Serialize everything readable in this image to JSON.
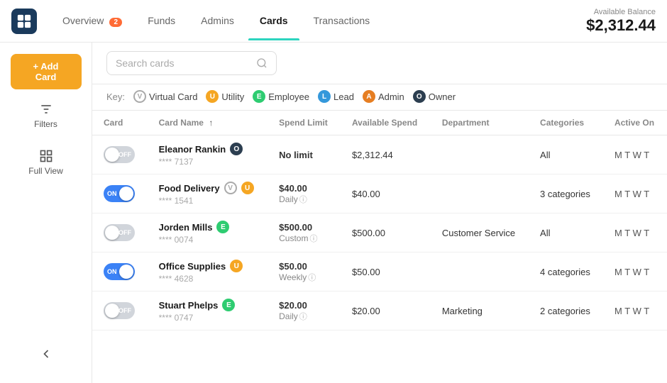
{
  "nav": {
    "items": [
      {
        "label": "Overview",
        "badge": "2",
        "active": false
      },
      {
        "label": "Funds",
        "badge": null,
        "active": false
      },
      {
        "label": "Admins",
        "badge": null,
        "active": false
      },
      {
        "label": "Cards",
        "badge": null,
        "active": true
      },
      {
        "label": "Transactions",
        "badge": null,
        "active": false
      }
    ],
    "balance_label": "Available Balance",
    "balance_amount": "$2,312.44"
  },
  "sidebar": {
    "add_card": "+ Add Card",
    "filters": "Filters",
    "full_view": "Full View"
  },
  "toolbar": {
    "search_placeholder": "Search cards"
  },
  "key": {
    "label": "Key:",
    "items": [
      {
        "badge": "V",
        "type": "v",
        "label": "Virtual Card"
      },
      {
        "badge": "U",
        "type": "u",
        "label": "Utility"
      },
      {
        "badge": "E",
        "type": "e",
        "label": "Employee"
      },
      {
        "badge": "L",
        "type": "l",
        "label": "Lead"
      },
      {
        "badge": "A",
        "type": "a",
        "label": "Admin"
      },
      {
        "badge": "O",
        "type": "o",
        "label": "Owner"
      }
    ]
  },
  "table": {
    "headers": [
      "Card",
      "Card Name",
      "Spend Limit",
      "Available Spend",
      "Department",
      "Categories",
      "Active On"
    ],
    "rows": [
      {
        "toggle": "off",
        "name": "Eleanor Rankin",
        "badge": "O",
        "badge_type": "o",
        "number": "**** 7137",
        "spend_limit": "No limit",
        "spend_period": "",
        "available_spend": "$2,312.44",
        "department": "",
        "categories": "All",
        "active_on": "M T W T"
      },
      {
        "toggle": "on",
        "name": "Food Delivery",
        "badge": "V",
        "badge_type": "v",
        "badge2": "U",
        "badge2_type": "u",
        "number": "**** 1541",
        "spend_limit": "$40.00",
        "spend_period": "Daily",
        "available_spend": "$40.00",
        "department": "",
        "categories": "3 categories",
        "active_on": "M T W T"
      },
      {
        "toggle": "off",
        "name": "Jorden Mills",
        "badge": "E",
        "badge_type": "e",
        "number": "**** 0074",
        "spend_limit": "$500.00",
        "spend_period": "Custom",
        "available_spend": "$500.00",
        "department": "Customer Service",
        "categories": "All",
        "active_on": "M T W T"
      },
      {
        "toggle": "on",
        "name": "Office Supplies",
        "badge": "U",
        "badge_type": "u",
        "number": "**** 4628",
        "spend_limit": "$50.00",
        "spend_period": "Weekly",
        "available_spend": "$50.00",
        "department": "",
        "categories": "4 categories",
        "active_on": "M T W T"
      },
      {
        "toggle": "off",
        "name": "Stuart Phelps",
        "badge": "E",
        "badge_type": "e",
        "number": "**** 0747",
        "spend_limit": "$20.00",
        "spend_period": "Daily",
        "available_spend": "$20.00",
        "department": "Marketing",
        "categories": "2 categories",
        "active_on": "M T W T"
      }
    ]
  },
  "colors": {
    "teal": "#2dd4bf",
    "orange": "#f5a623",
    "blue": "#3b82f6"
  }
}
